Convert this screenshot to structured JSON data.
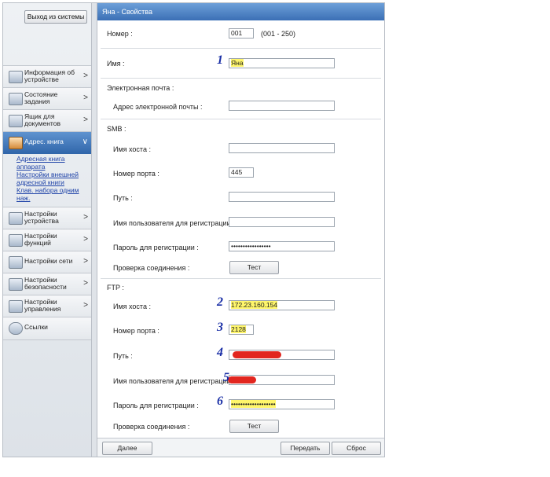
{
  "sidebar": {
    "logout_label": "Выход из системы",
    "items": [
      {
        "label": "Информация об устройстве"
      },
      {
        "label": "Состояние задания"
      },
      {
        "label": "Ящик для документов"
      },
      {
        "label": "Адрес. книга"
      },
      {
        "label": "Настройки устройства"
      },
      {
        "label": "Настройки функций"
      },
      {
        "label": "Настройки сети"
      },
      {
        "label": "Настройки безопасности"
      },
      {
        "label": "Настройки управления"
      },
      {
        "label": "Ссылки"
      }
    ],
    "sub_links": [
      "Адресная книга аппарата",
      "Настройки внешней адресной книги",
      "Клав. набора одним наж."
    ]
  },
  "panel": {
    "title": "Яна - Свойства",
    "number_label": "Номер :",
    "number_value": "001",
    "number_range": "(001 - 250)",
    "name_label": "Имя :",
    "name_value": "Яна",
    "email_section": "Электронная почта :",
    "email_label": "Адрес электронной почты :",
    "email_value": "",
    "smb": {
      "section": "SMB :",
      "host_label": "Имя хоста :",
      "host_value": "",
      "port_label": "Номер порта :",
      "port_value": "445",
      "path_label": "Путь :",
      "path_value": "",
      "user_label": "Имя пользователя для регистрации :",
      "user_value": "",
      "password_label": "Пароль для регистрации :",
      "password_value": "•••••••••••••••••",
      "check_label": "Проверка соединения :",
      "test_label": "Тест"
    },
    "ftp": {
      "section": "FTP :",
      "host_label": "Имя хоста :",
      "host_value": "172.23.160.154",
      "port_label": "Номер порта :",
      "port_value": "2128",
      "path_label": "Путь :",
      "user_label": "Имя пользователя для регистрации :",
      "password_label": "Пароль для регистрации :",
      "password_value": "•••••••••••••••••••",
      "check_label": "Проверка соединения :",
      "test_label": "Тест"
    },
    "footer": {
      "next_label": "Далее",
      "send_label": "Передать",
      "reset_label": "Сброс"
    }
  },
  "annotations": [
    "1",
    "2",
    "3",
    "4",
    "5",
    "6"
  ]
}
